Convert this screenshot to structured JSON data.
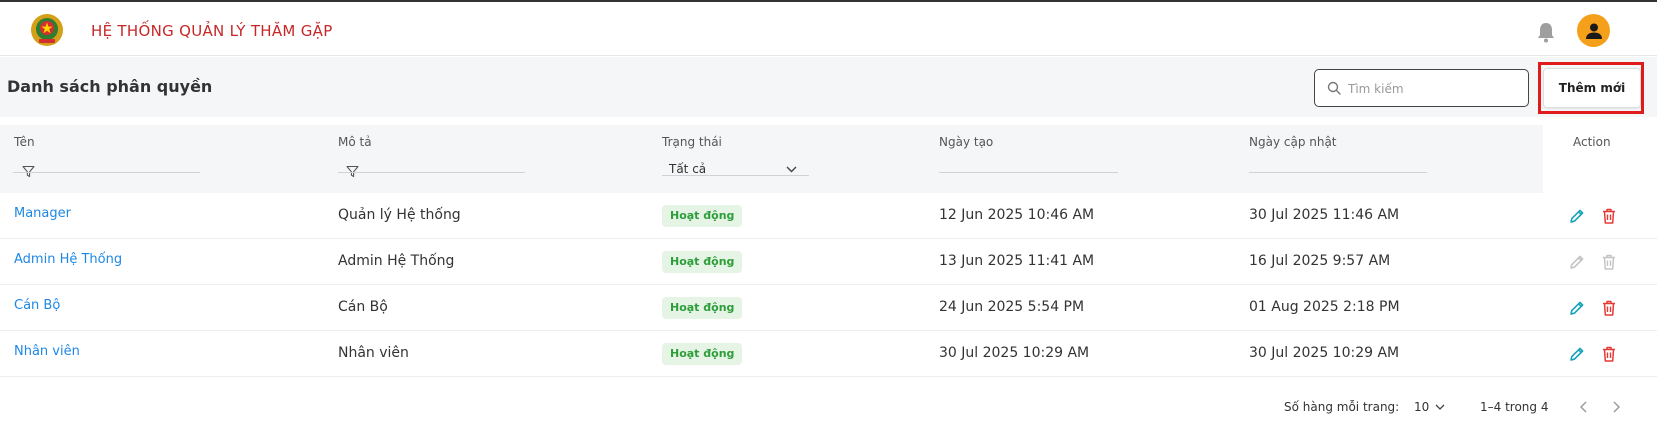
{
  "header": {
    "app_title": "HỆ THỐNG QUẢN LÝ THĂM GẶP",
    "logo_icon": "police-emblem-icon",
    "notification_icon": "bell-icon",
    "avatar_icon": "user-avatar-icon"
  },
  "toolbar": {
    "page_title": "Danh sách phân quyền",
    "search_placeholder": "Tìm kiếm",
    "search_value": "",
    "add_label": "Thêm mới"
  },
  "table": {
    "columns": {
      "name": "Tên",
      "description": "Mô tả",
      "status": "Trạng thái",
      "created": "Ngày tạo",
      "updated": "Ngày cập nhật",
      "action": "Action"
    },
    "status_filter_value": "Tất cả",
    "rows": [
      {
        "name": "Manager",
        "description": "Quản lý Hệ thống",
        "status": "Hoạt động",
        "created": "12 Jun 2025 10:46 AM",
        "updated": "30 Jul 2025 11:46 AM",
        "actions_enabled": true
      },
      {
        "name": "Admin Hệ Thống",
        "description": "Admin Hệ Thống",
        "status": "Hoạt động",
        "created": "13 Jun 2025 11:41 AM",
        "updated": "16 Jul 2025 9:57 AM",
        "actions_enabled": false
      },
      {
        "name": "Cán Bộ",
        "description": "Cán Bộ",
        "status": "Hoạt động",
        "created": "24 Jun 2025 5:54 PM",
        "updated": "01 Aug 2025 2:18 PM",
        "actions_enabled": true
      },
      {
        "name": "Nhân viên",
        "description": "Nhân viên",
        "status": "Hoạt động",
        "created": "30 Jul 2025 10:29 AM",
        "updated": "30 Jul 2025 10:29 AM",
        "actions_enabled": true
      }
    ]
  },
  "pagination": {
    "rows_per_page_label": "Số hàng mỗi trang:",
    "rows_per_page_value": "10",
    "range_label": "1–4 trong 4"
  },
  "colors": {
    "brand_red": "#c62828",
    "link_blue": "#1e88e5",
    "edit_teal": "#17a2b8",
    "delete_red": "#e53935",
    "badge_green": "#2e9e3a",
    "avatar_orange": "#f5a01a"
  }
}
